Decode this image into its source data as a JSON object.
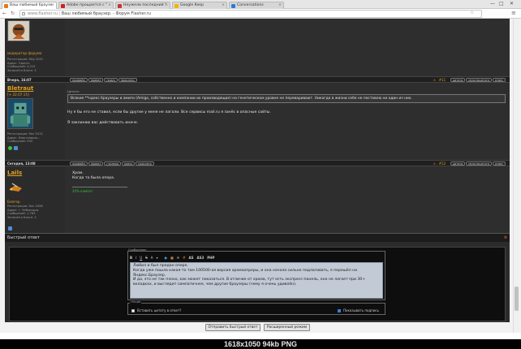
{
  "browser": {
    "tabs": [
      {
        "title": "Ваш любимый браузе",
        "color": "#e07b20"
      },
      {
        "title": "Adobe прощается с \"",
        "color": "#cc2222"
      },
      {
        "title": "Неужели последний \"",
        "color": "#cc3333"
      },
      {
        "title": "Google Keep",
        "color": "#f4b400"
      },
      {
        "title": "Conversations",
        "color": "#2a7bd4"
      }
    ],
    "url_host": "www.flasher.ru",
    "url_title": "Ваш любимый браузер. - Форум Flasher.ru",
    "window_controls": [
      "—",
      "□",
      "✕"
    ]
  },
  "posts": [
    {
      "user_rank": "модератор форума",
      "user_info": "Регистрация: May 2001\nАдрес: Одесса\nСообщений: 4,219\nЗаписей в блоге: 3",
      "date": "Вчера, 16:07",
      "buttons_left": [
        "профайл",
        "приват",
        "поиск",
        "прислать"
      ],
      "post_num": "#11",
      "buttons_right": [
        "цитата",
        "мультицитата",
        "ответ"
      ]
    },
    {
      "username": "Bletraut",
      "user_rank": "[+ 22.07.15]",
      "user_info": "Регистрация: Mar 2013\nАдрес: Имагинария...\nСообщений: 334",
      "quote_label": "Цитата:",
      "quote": "Всякие **ндекс браузеры и амиги (Amigo, собственно и компании их производящие) на генетическом уровне не переваривают. Никогда в жизни себе не поставлю ни один из них.",
      "text1": "Ну я бы его не ставил, если бы другие у меня не лагали. Все сервисы mail.ru я занёс в опасные сайты.",
      "text2": "Я заклинаю вас действовать иначе.",
      "date": "Сегодня, 13:08",
      "buttons_left": [
        "профайл",
        "приват",
        "гэллери",
        "поиск",
        "прислать"
      ],
      "post_num": "#12",
      "buttons_right": [
        "цитата",
        "мультицитата",
        "ответ"
      ]
    },
    {
      "username": "Lails",
      "user_rank": "Блогер",
      "user_info": "Регистрация: Dec 2008\nАдрес: г. Чебоксары\nСообщений: 1,783\nЗаписей в блоге: 3",
      "text1": "Хром.",
      "text2": "Когда то была опера.",
      "signature": "20% кампот"
    }
  ],
  "quick_reply": {
    "title": "Быстрый ответ",
    "message_legend": "Сообщение:",
    "toolbar": [
      "B",
      "I",
      "U",
      "S",
      "A",
      "▾",
      "AS",
      "AS3",
      "PHP"
    ],
    "editor_text": "Любил и был предан опере.\nКогда уже пошла какая-то там 100500-ая версия хромоопреры, и она начала сильно подлагивать, я перешёл на Яндекс.Браузер.\nИ да, это не так плохо, как может показаться. В отличие от хрома, тут есть экспресс-панель, оно не лагает при 30+ вкладках, и выглядит симпатичнее, чем другие браузеры (чему я очень удивлён).",
    "options_legend": "Опции",
    "option_quote": "Вставить цитату в ответ?",
    "option_signature": "Показывать подпись",
    "btn_submit": "Отправить быстрый ответ",
    "btn_advanced": "Расширенный режим"
  },
  "caption": "1618x1050  94kb  PNG"
}
